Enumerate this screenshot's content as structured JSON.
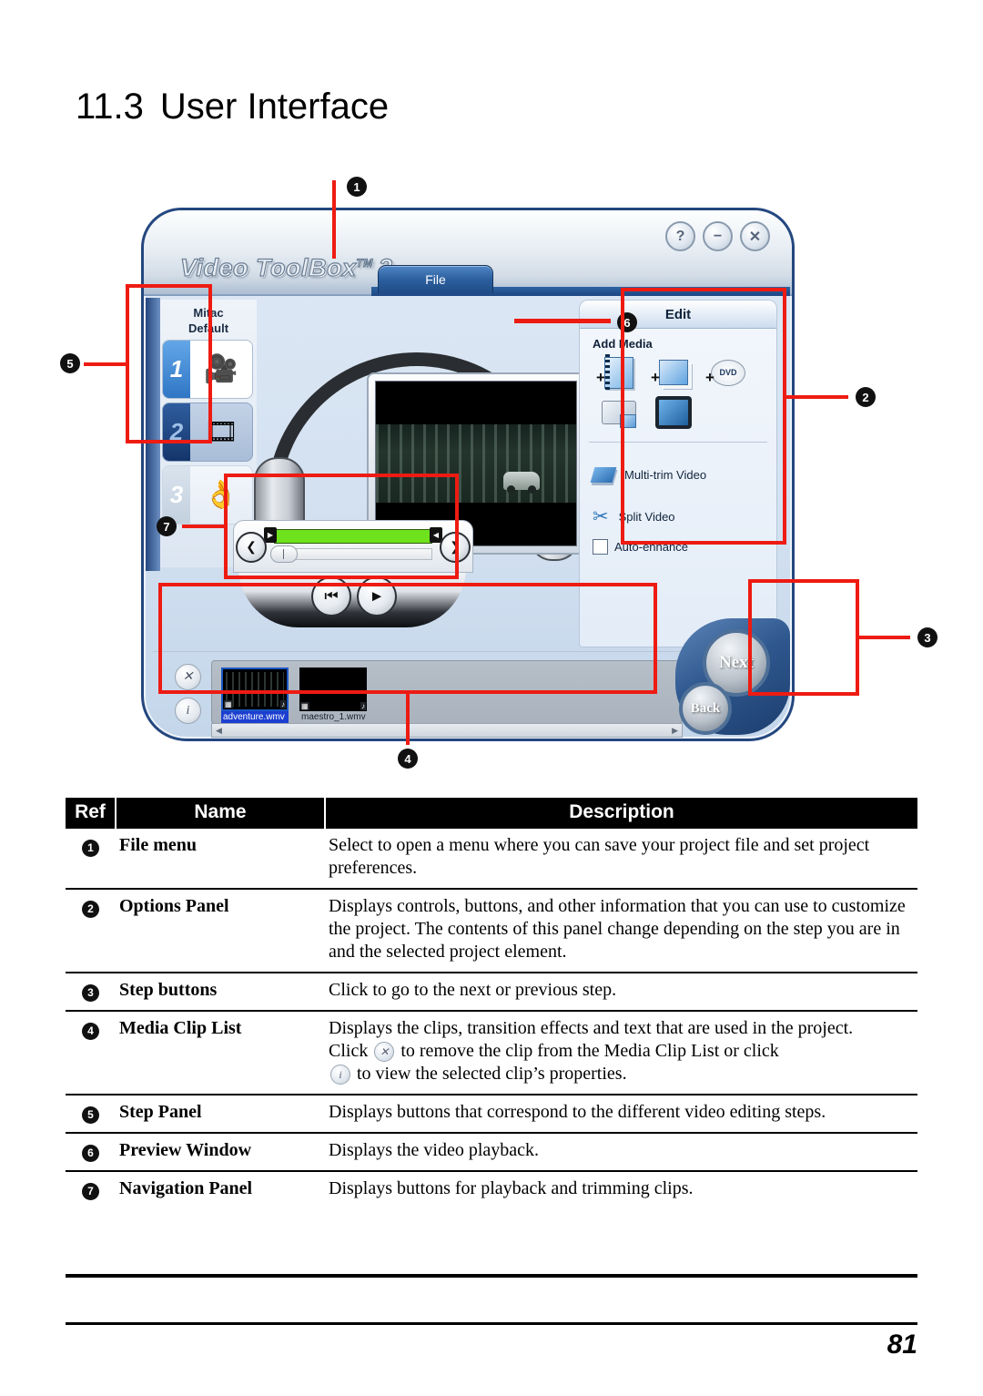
{
  "heading": {
    "number": "11.3",
    "text": "User Interface"
  },
  "app": {
    "logo": "Video ToolBox",
    "logo_tm": "TM",
    "logo_version": "2",
    "file_tab": "File",
    "window_buttons": [
      {
        "name": "help-button",
        "glyph": "?"
      },
      {
        "name": "minimize-button",
        "glyph": "−"
      },
      {
        "name": "close-button",
        "glyph": "✕"
      }
    ],
    "step_panel": {
      "title_line1": "Mitac",
      "title_line2": "Default",
      "steps": [
        {
          "number": "1",
          "icon": "capture-camcorder-icon"
        },
        {
          "number": "2",
          "icon": "edit-filmstrip-icon"
        },
        {
          "number": "3",
          "icon": "finish-ok-hand-icon"
        }
      ]
    },
    "options_panel": {
      "title": "Edit",
      "add_media_label": "Add Media",
      "add_media_icons": [
        {
          "name": "add-video-icon",
          "plus": "+"
        },
        {
          "name": "add-image-icon",
          "plus": "+"
        },
        {
          "name": "add-dvd-icon",
          "plus": "+",
          "label": "DVD"
        },
        {
          "name": "capture-camcorder-icon",
          "plus": ""
        },
        {
          "name": "capture-tv-icon",
          "plus": ""
        }
      ],
      "tools": [
        {
          "label": "Multi-trim Video",
          "icon": "multi-trim-icon"
        },
        {
          "label": "Split Video",
          "icon": "scissors-icon"
        }
      ],
      "checkbox": {
        "label": "Auto-enhance",
        "checked": false
      }
    },
    "media_clip_list": {
      "remove_icon": "✕",
      "info_icon": "i",
      "clips": [
        {
          "name": "adventure.wmv",
          "selected": true
        },
        {
          "name": "maestro_1.wmv",
          "selected": false
        }
      ],
      "scroll_left": "◀",
      "scroll_right": "▶"
    },
    "navigation_panel": {
      "prev_icon": "❮",
      "next_icon": "❯",
      "start_icon": "⏮",
      "play_icon": "▶",
      "trim_left_icon": "▶",
      "trim_right_icon": "◀"
    },
    "step_buttons": {
      "next": "Next",
      "back": "Back"
    }
  },
  "callouts": [
    {
      "id": "1",
      "glyph": "❶"
    },
    {
      "id": "2",
      "glyph": "❷"
    },
    {
      "id": "3",
      "glyph": "❸"
    },
    {
      "id": "4",
      "glyph": "❹"
    },
    {
      "id": "5",
      "glyph": "❺"
    },
    {
      "id": "6",
      "glyph": "❻"
    },
    {
      "id": "7",
      "glyph": "❼"
    }
  ],
  "table": {
    "headers": {
      "ref": "Ref",
      "name": "Name",
      "description": "Description"
    },
    "rows": [
      {
        "ref": "1",
        "name": "File menu",
        "description": "Select to open a menu where you can save your project file and set project preferences."
      },
      {
        "ref": "2",
        "name": "Options Panel",
        "description": "Displays controls, buttons, and other information that you can use to customize the project. The contents of this panel change depending on the step you are in and the selected project element."
      },
      {
        "ref": "3",
        "name": "Step buttons",
        "description": "Click to go to the next or previous step."
      },
      {
        "ref": "4",
        "name": "Media Clip List",
        "description_part1": "Displays the clips, transition effects and text that are used in the project.",
        "description_part2": "Click",
        "description_part3": "to remove the clip from the Media Clip List or click",
        "description_part4": "to view the selected clip’s properties.",
        "icon_remove": "✕",
        "icon_info": "i"
      },
      {
        "ref": "5",
        "name": "Step Panel",
        "description": "Displays buttons that correspond to the different video editing steps."
      },
      {
        "ref": "6",
        "name": "Preview Window",
        "description": "Displays the video playback."
      },
      {
        "ref": "7",
        "name": "Navigation Panel",
        "description": "Displays buttons for playback and trimming clips."
      }
    ]
  },
  "footer": {
    "page_number": "81"
  }
}
